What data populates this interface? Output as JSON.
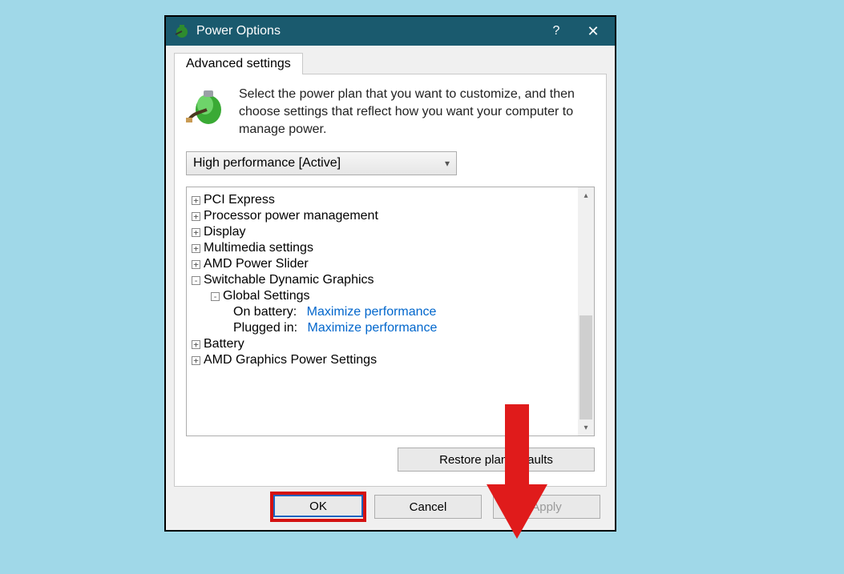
{
  "window": {
    "title": "Power Options",
    "help": "?",
    "close": "✕"
  },
  "tab": {
    "label": "Advanced settings"
  },
  "intro": "Select the power plan that you want to customize, and then choose settings that reflect how you want your computer to manage power.",
  "plan": {
    "selected": "High performance [Active]"
  },
  "tree": {
    "items": [
      {
        "label": "PCI Express"
      },
      {
        "label": "Processor power management"
      },
      {
        "label": "Display"
      },
      {
        "label": "Multimedia settings"
      },
      {
        "label": "AMD Power Slider"
      },
      {
        "label": "Switchable Dynamic Graphics"
      },
      {
        "label": "Battery"
      },
      {
        "label": "AMD Graphics Power Settings"
      }
    ],
    "global_settings": {
      "label": "Global Settings"
    },
    "on_battery": {
      "label": "On battery:",
      "value": "Maximize performance"
    },
    "plugged_in": {
      "label": "Plugged in:",
      "value": "Maximize performance"
    }
  },
  "buttons": {
    "restore": "Restore plan defaults",
    "ok": "OK",
    "cancel": "Cancel",
    "apply": "Apply"
  }
}
